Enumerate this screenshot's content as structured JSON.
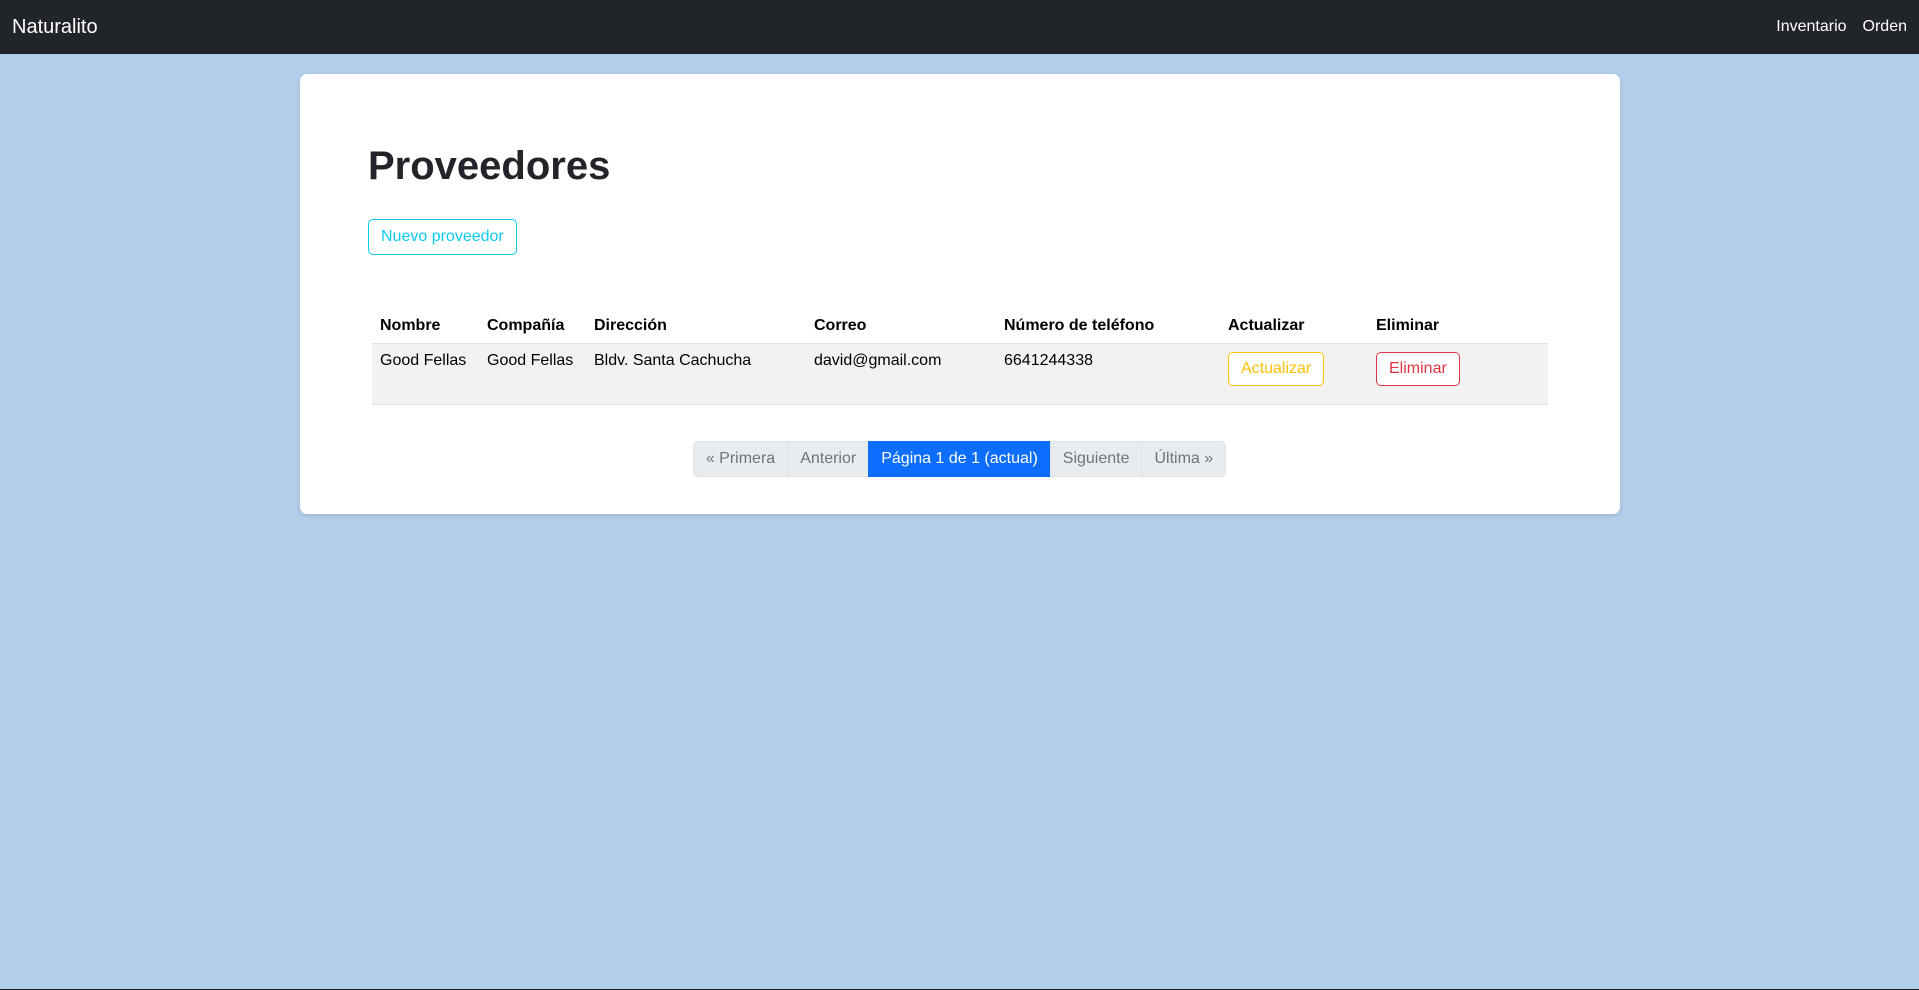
{
  "navbar": {
    "brand": "Naturalito",
    "links": [
      "Inventario",
      "Orden"
    ]
  },
  "page": {
    "title": "Proveedores",
    "new_button": "Nuevo proveedor"
  },
  "table": {
    "headers": [
      "Nombre",
      "Compañía",
      "Dirección",
      "Correo",
      "Número de teléfono",
      "Actualizar",
      "Eliminar"
    ],
    "rows": [
      {
        "nombre": "Good Fellas",
        "compania": "Good Fellas",
        "direccion": "Bldv. Santa Cachucha",
        "correo": "david@gmail.com",
        "telefono": "6641244338",
        "update_label": "Actualizar",
        "delete_label": "Eliminar"
      }
    ]
  },
  "pagination": {
    "first": "« Primera",
    "prev": "Anterior",
    "current": "Página 1 de 1 (actual)",
    "next": "Siguiente",
    "last": "Última »"
  }
}
